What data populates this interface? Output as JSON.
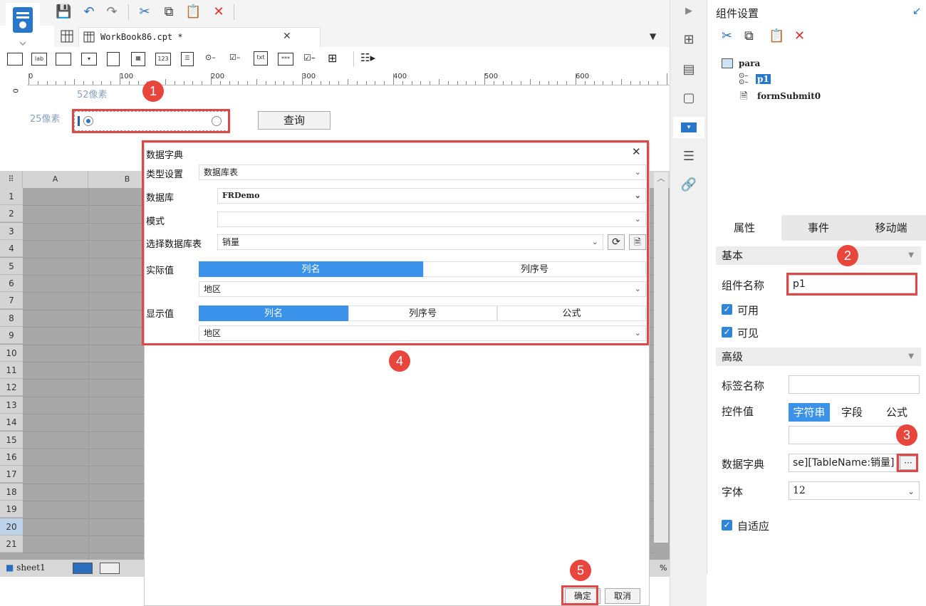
{
  "file_tab": {
    "title": "WorkBook86.cpt *",
    "close": "✕"
  },
  "toolbar": {
    "save": "💾",
    "undo": "↶",
    "redo": "↷",
    "cut": "✂",
    "copy": "⧉",
    "paste": "📋",
    "delete": "✕"
  },
  "widget_toolbar": {
    "label_icon": "lab",
    "numeric_icon": "123",
    "text_icon": "txt",
    "password_icon": "***"
  },
  "ruler": {
    "marks": [
      "0",
      "100",
      "200",
      "300",
      "400",
      "500",
      "600"
    ],
    "left_mark": "0"
  },
  "form_canvas": {
    "width_hint": "52像素",
    "height_hint": "25像素",
    "query_button": "查询"
  },
  "grid": {
    "columns": [
      "A",
      "B"
    ],
    "rows": [
      "1",
      "2",
      "3",
      "4",
      "5",
      "6",
      "7",
      "8",
      "9",
      "10",
      "11",
      "12",
      "13",
      "14",
      "15",
      "16",
      "17",
      "18",
      "19",
      "20",
      "21"
    ]
  },
  "sheetbar": {
    "sheet_name": "sheet1",
    "percent": "%"
  },
  "dialog": {
    "title": "数据字典",
    "type_label": "类型设置",
    "type_value": "数据库表",
    "db_label": "数据库",
    "db_value": "FRDemo",
    "mode_label": "模式",
    "mode_value": "",
    "table_label": "选择数据库表",
    "table_value": "销量",
    "actual_label": "实际值",
    "actual_segments": [
      "列名",
      "列序号"
    ],
    "actual_value": "地区",
    "display_label": "显示值",
    "display_segments": [
      "列名",
      "列序号",
      "公式"
    ],
    "display_value": "地区",
    "ok": "确定",
    "cancel": "取消"
  },
  "right_panel": {
    "title": "组件设置",
    "tree": {
      "root": "para",
      "child1": "p1",
      "child2": "formSubmit0"
    },
    "tabs": [
      "属性",
      "事件",
      "移动端"
    ],
    "basic_section": "基本",
    "name_label": "组件名称",
    "name_value": "p1",
    "enabled_label": "可用",
    "visible_label": "可见",
    "advanced_section": "高级",
    "tag_label": "标签名称",
    "tag_value": "",
    "value_label": "控件值",
    "value_segments": [
      "字符串",
      "字段",
      "公式"
    ],
    "value_input": "",
    "dict_label": "数据字典",
    "dict_value": "se][TableName:销量]",
    "dict_button": "···",
    "font_label": "字体",
    "font_value": "12",
    "autofit_label": "自适应"
  },
  "badges": [
    "1",
    "2",
    "3",
    "4",
    "5"
  ],
  "colors": {
    "accent": "#3a92ea",
    "highlight": "#e04848",
    "badge": "#e8453c"
  }
}
